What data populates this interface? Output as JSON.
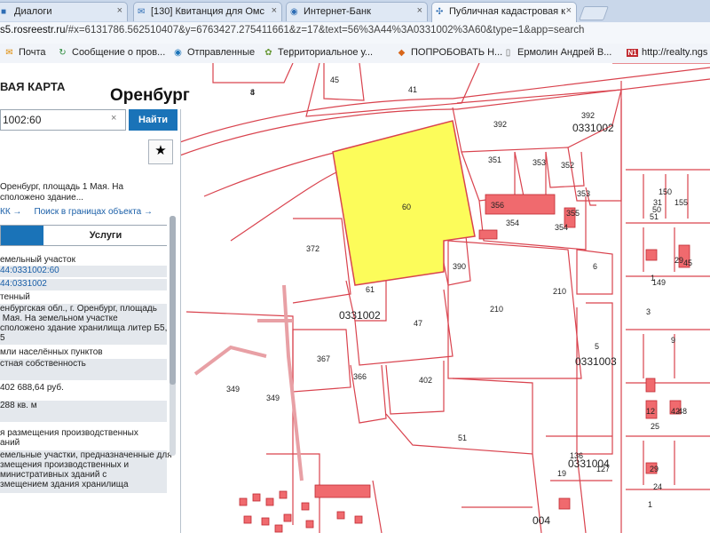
{
  "browser": {
    "tabs": [
      {
        "label": "Диалоги",
        "icon": "vk-icon"
      },
      {
        "label": "[130] Квитанция для Омс",
        "icon": "mail-icon"
      },
      {
        "label": "Интернет-Банк",
        "icon": "bank-icon"
      },
      {
        "label": "Публичная кадастровая к",
        "icon": "map-icon"
      }
    ],
    "address_host": "s5.rosreestr.ru",
    "address_rest": "/#x=6131786.562510407&y=6763427.275411661&z=17&text=56%3A44%3A0331002%3A60&type=1&app=search",
    "bookmarks": [
      {
        "label": "Почта",
        "icon": "mail-icon"
      },
      {
        "label": "Сообщение о пров...",
        "icon": "refresh-icon"
      },
      {
        "label": "Отправленные",
        "icon": "globe-icon"
      },
      {
        "label": "Территориальное у...",
        "icon": "page-icon"
      },
      {
        "label": "ПОПРОБОВАТЬ Н...",
        "icon": "pizza-icon"
      },
      {
        "label": "Ермолин Андрей В...",
        "icon": "person-icon"
      },
      {
        "label": "http://realty.ngs",
        "icon": "n1-icon"
      }
    ]
  },
  "app": {
    "title": "ВАЯ КАРТА",
    "city": "Оренбург"
  },
  "search": {
    "value": "1002:60",
    "clear": "×",
    "button": "Найти",
    "favorite": "★"
  },
  "result": {
    "desc_line1": "Оренбург, площадь 1 Мая. На",
    "desc_line2": "сположено здание...",
    "link_kk": "КК →",
    "link_search": "Поиск в границах объекта →",
    "tab_services": "Услуги",
    "rows": [
      "емельный участок",
      "44:0331002:60",
      "44:0331002",
      "тенный",
      "енбургская обл., г. Оренбург, площадь\n Мая. На земельном участке\nсположено здание хранилища литер Б5,\n5",
      "мли населённых пунктов",
      "стная собственность",
      "402 688,64 руб.",
      "288 кв. м",
      "я размещения производственных\nаний",
      "емельные участки, предназначенные для\nзмещения производственных и\nминистративных зданий с\nзмещением здания хранилища"
    ]
  },
  "map_labels": {
    "selected": "60",
    "quarters": [
      "0331002",
      "0331002",
      "0331003",
      "0331004",
      "004"
    ],
    "parcels": [
      "4",
      "45",
      "41",
      "392",
      "392",
      "351",
      "353",
      "352",
      "354",
      "356",
      "353",
      "355",
      "354",
      "349",
      "372",
      "390",
      "6",
      "61",
      "210",
      "210",
      "47",
      "367",
      "366",
      "402",
      "349",
      "51",
      "5",
      "1",
      "3",
      "9",
      "12",
      "25",
      "42",
      "48",
      "45",
      "29",
      "149",
      "150",
      "155",
      "31",
      "50",
      "51",
      "136",
      "127",
      "19",
      "29",
      "24",
      "1",
      "8"
    ]
  },
  "colors": {
    "selected_fill": "#fcfc5a",
    "boundary": "#d9434e",
    "building": "#f06a6e",
    "accent": "#1a73b8"
  }
}
